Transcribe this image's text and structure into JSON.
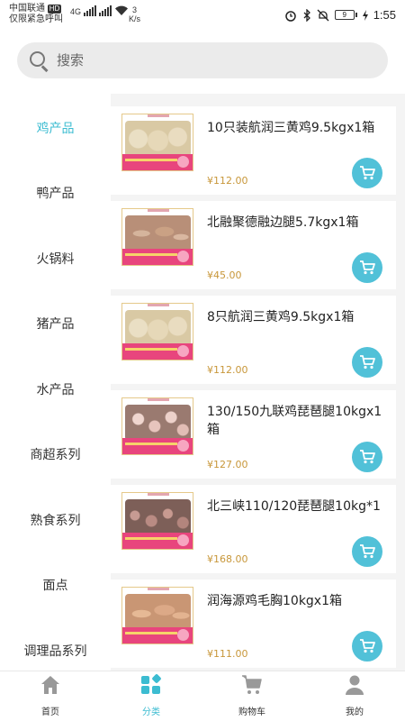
{
  "status_bar": {
    "carrier_line1": "中国联通",
    "hd_badge": "HD",
    "carrier_line2": "仅限紧急呼叫",
    "network": "4G",
    "speed_value": "3",
    "speed_unit": "K/s",
    "battery": "9",
    "time": "1:55"
  },
  "search": {
    "placeholder": "搜索"
  },
  "categories": [
    {
      "label": "鸡产品",
      "active": true
    },
    {
      "label": "鸭产品",
      "active": false
    },
    {
      "label": "火锅料",
      "active": false
    },
    {
      "label": "猪产品",
      "active": false
    },
    {
      "label": "水产品",
      "active": false
    },
    {
      "label": "商超系列",
      "active": false
    },
    {
      "label": "熟食系列",
      "active": false
    },
    {
      "label": "面点",
      "active": false
    },
    {
      "label": "调理品系列",
      "active": false
    }
  ],
  "products": [
    {
      "name": "10只装航润三黄鸡9.5kgx1箱",
      "price": "¥112.00",
      "image": "chicken"
    },
    {
      "name": "北融聚德融边腿5.7kgx1箱",
      "price": "¥45.00",
      "image": "leg"
    },
    {
      "name": "8只航润三黄鸡9.5kgx1箱",
      "price": "¥112.00",
      "image": "chicken"
    },
    {
      "name": "130/150九联鸡琵琶腿10kgx1箱",
      "price": "¥127.00",
      "image": "wing"
    },
    {
      "name": "北三峡110/120琵琶腿10kg*1",
      "price": "¥168.00",
      "image": "dark"
    },
    {
      "name": "润海源鸡毛胸10kgx1箱",
      "price": "¥111.00",
      "image": "breast"
    }
  ],
  "bottom_nav": {
    "home": "首页",
    "category": "分类",
    "cart": "购物车",
    "mine": "我的"
  },
  "colors": {
    "accent": "#3cbcd1",
    "cart_button": "#51c1d8",
    "price": "#c8973a"
  }
}
